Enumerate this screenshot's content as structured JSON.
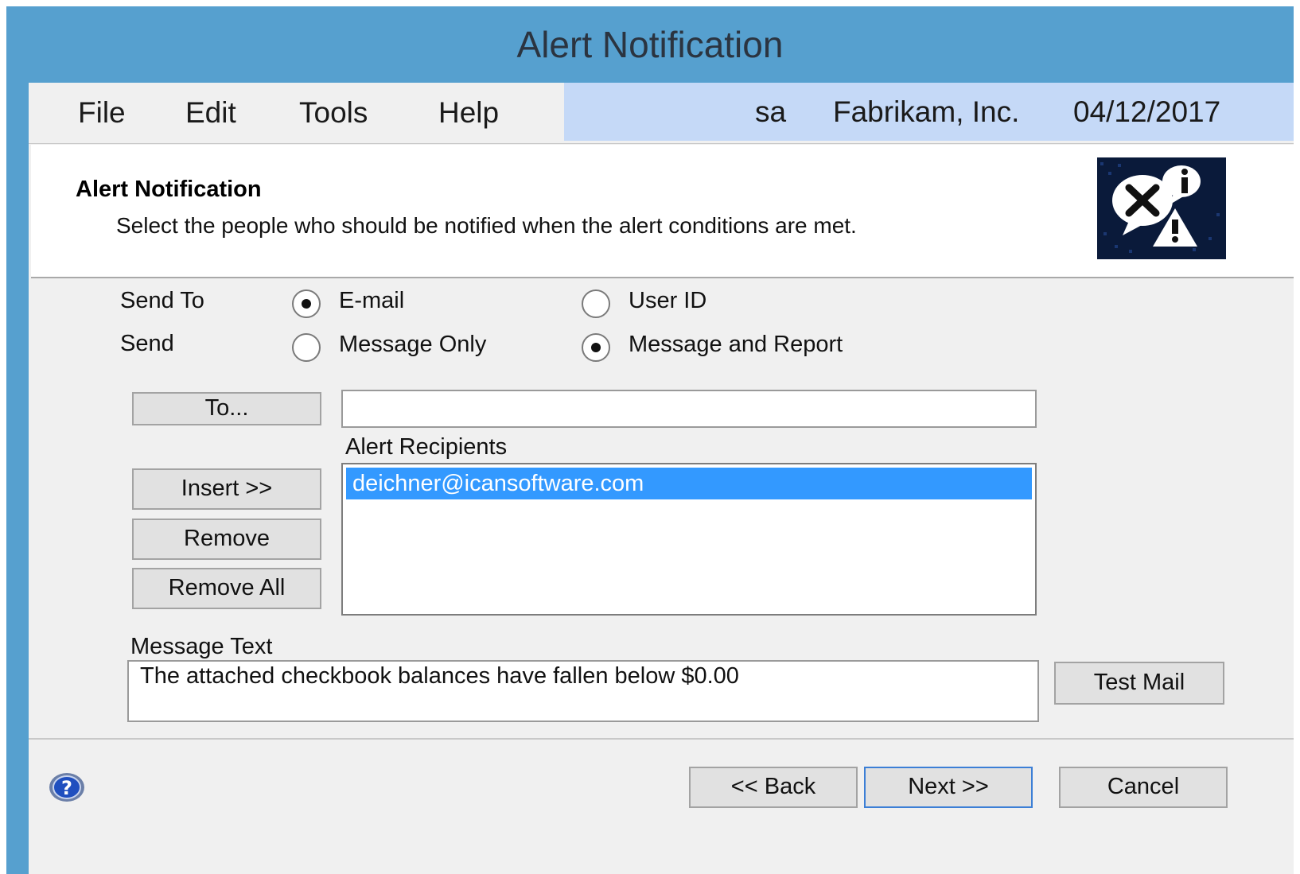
{
  "window": {
    "title": "Alert Notification"
  },
  "menu": {
    "items": [
      "File",
      "Edit",
      "Tools",
      "Help"
    ],
    "user": "sa",
    "company": "Fabrikam, Inc.",
    "date": "04/12/2017"
  },
  "header": {
    "title": "Alert Notification",
    "description": "Select the people who should be notified when the alert conditions are met.",
    "icon": "alert-icon"
  },
  "options": {
    "send_to_label": "Send To",
    "send_label": "Send",
    "send_to_email": "E-mail",
    "send_to_userid": "User ID",
    "send_to_selected": "E-mail",
    "send_message_only": "Message Only",
    "send_message_report": "Message and Report",
    "send_selected": "Message and Report"
  },
  "recipients": {
    "to_button": "To...",
    "to_value": "",
    "list_label": "Alert Recipients",
    "items": [
      "deichner@icansoftware.com"
    ],
    "selected_index": 0,
    "insert_button": "Insert >>",
    "remove_button": "Remove",
    "remove_all_button": "Remove All"
  },
  "message": {
    "label": "Message Text",
    "text": "The attached checkbook balances have fallen below $0.00",
    "test_mail_button": "Test Mail"
  },
  "footer": {
    "back_button": "<< Back",
    "next_button": "Next >>",
    "cancel_button": "Cancel",
    "help_icon": "help-icon"
  }
}
